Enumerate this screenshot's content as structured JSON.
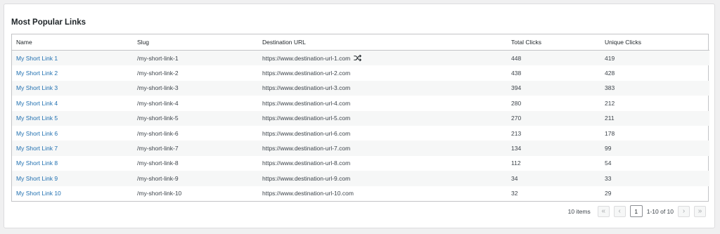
{
  "card": {
    "title": "Most Popular Links"
  },
  "table": {
    "headers": {
      "name": "Name",
      "slug": "Slug",
      "destination": "Destination URL",
      "total": "Total Clicks",
      "unique": "Unique Clicks"
    },
    "rows": [
      {
        "name": "My Short Link 1",
        "slug": "/my-short-link-1",
        "url": "https://www.destination-url-1.com",
        "total": "448",
        "unique": "419"
      },
      {
        "name": "My Short Link 2",
        "slug": "/my-short-link-2",
        "url": "https://www.destination-url-2.com",
        "total": "438",
        "unique": "428"
      },
      {
        "name": "My Short Link 3",
        "slug": "/my-short-link-3",
        "url": "https://www.destination-url-3.com",
        "total": "394",
        "unique": "383"
      },
      {
        "name": "My Short Link 4",
        "slug": "/my-short-link-4",
        "url": "https://www.destination-url-4.com",
        "total": "280",
        "unique": "212"
      },
      {
        "name": "My Short Link 5",
        "slug": "/my-short-link-5",
        "url": "https://www.destination-url-5.com",
        "total": "270",
        "unique": "211"
      },
      {
        "name": "My Short Link 6",
        "slug": "/my-short-link-6",
        "url": "https://www.destination-url-6.com",
        "total": "213",
        "unique": "178"
      },
      {
        "name": "My Short Link 7",
        "slug": "/my-short-link-7",
        "url": "https://www.destination-url-7.com",
        "total": "134",
        "unique": "99"
      },
      {
        "name": "My Short Link 8",
        "slug": "/my-short-link-8",
        "url": "https://www.destination-url-8.com",
        "total": "112",
        "unique": "54"
      },
      {
        "name": "My Short Link 9",
        "slug": "/my-short-link-9",
        "url": "https://www.destination-url-9.com",
        "total": "34",
        "unique": "33"
      },
      {
        "name": "My Short Link 10",
        "slug": "/my-short-link-10",
        "url": "https://www.destination-url-10.com",
        "total": "32",
        "unique": "29"
      }
    ],
    "row_icon": "shuffle-icon"
  },
  "pagination": {
    "items_count": "10 items",
    "first": "«",
    "prev": "‹",
    "current_page": "1",
    "page_info": "1-10 of 10",
    "next": "›",
    "last": "»"
  },
  "colors": {
    "link": "#2271b1",
    "stripe": "#f6f7f7",
    "border": "#c3c4c7",
    "background": "#f0f0f1"
  }
}
